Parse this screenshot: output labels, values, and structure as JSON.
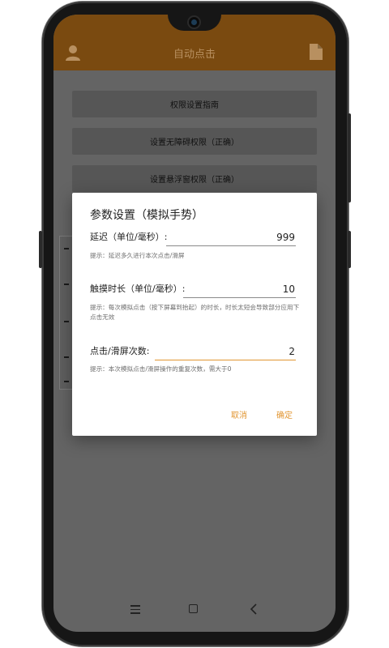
{
  "app": {
    "title": "自动点击"
  },
  "main": {
    "buttons": [
      {
        "label": "权限设置指南"
      },
      {
        "label": "设置无障碍权限（正确）"
      },
      {
        "label": "设置悬浮窗权限（正确）"
      }
    ]
  },
  "dialog": {
    "title": "参数设置（模拟手势）",
    "fields": [
      {
        "label": "延迟（单位/毫秒）:",
        "value": "999",
        "hint": "提示：延迟多久进行本次点击/滑屏"
      },
      {
        "label": "触摸时长（单位/毫秒）:",
        "value": "10",
        "hint": "提示：每次模拟点击（按下屏幕到抬起）的时长，时长太短会导致部分应用下点击无效"
      },
      {
        "label": "点击/滑屏次数:",
        "value": "2",
        "hint": "提示：本次模拟点击/滑屏操作的重复次数，需大于0"
      }
    ],
    "cancel_label": "取消",
    "ok_label": "确定"
  },
  "colors": {
    "accent": "#e29632",
    "appbar": "#7a4a10",
    "scrim_bg": "#646464"
  },
  "icons": [
    "user-icon",
    "file-icon",
    "menu-icon",
    "home-icon",
    "back-icon"
  ]
}
